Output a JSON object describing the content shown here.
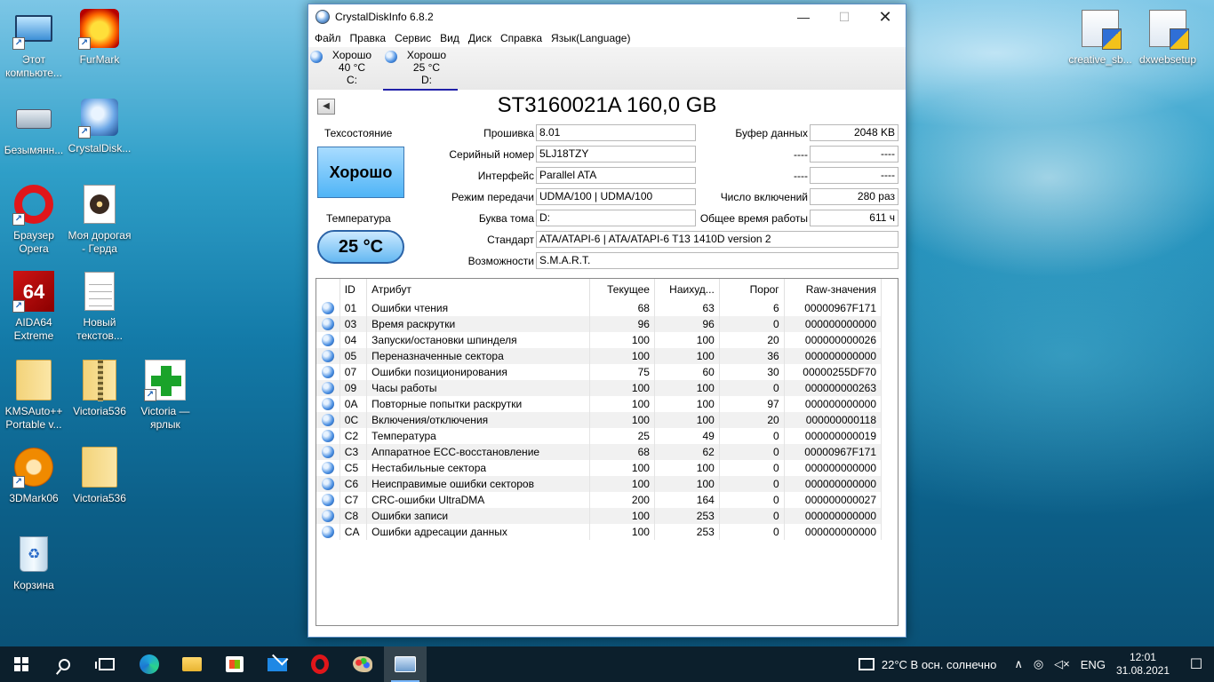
{
  "desktop": {
    "icons": [
      {
        "label": "Этот компьюте..."
      },
      {
        "label": "FurMark"
      },
      {
        "label": "Безымянн..."
      },
      {
        "label": "CrystalDisk..."
      },
      {
        "label": "Браузер Opera"
      },
      {
        "label": "Моя дорогая - Герда"
      },
      {
        "label": "AIDA64 Extreme",
        "badge": "64"
      },
      {
        "label": "Новый текстов..."
      },
      {
        "label": "KMSAuto++ Portable v..."
      },
      {
        "label": "Victoria536"
      },
      {
        "label": "Victoria — ярлык"
      },
      {
        "label": "3DMark06"
      },
      {
        "label": "Victoria536"
      },
      {
        "label": "Корзина"
      },
      {
        "label": "creative_sb..."
      },
      {
        "label": "dxwebsetup"
      }
    ]
  },
  "window": {
    "title": "CrystalDiskInfo 6.8.2",
    "controls": {
      "minimize": "—",
      "maximize": "☐",
      "close": "✕"
    },
    "menu": [
      "Файл",
      "Правка",
      "Сервис",
      "Вид",
      "Диск",
      "Справка",
      "Язык(Language)"
    ],
    "drives": [
      {
        "status": "Хорошо",
        "temp": "40 °C",
        "letter": "C:"
      },
      {
        "status": "Хорошо",
        "temp": "25 °C",
        "letter": "D:"
      }
    ],
    "model": "ST3160021A 160,0 GB",
    "health_label": "Техсостояние",
    "health_status": "Хорошо",
    "temp_label": "Температура",
    "temp_value": "25 °C",
    "fields": {
      "firmware": {
        "label": "Прошивка",
        "value": "8.01"
      },
      "serial": {
        "label": "Серийный номер",
        "value": "5LJ18TZY"
      },
      "interface": {
        "label": "Интерфейс",
        "value": "Parallel ATA"
      },
      "transfer": {
        "label": "Режим передачи",
        "value": "UDMA/100 | UDMA/100"
      },
      "volume": {
        "label": "Буква тома",
        "value": "D:"
      },
      "standard": {
        "label": "Стандарт",
        "value": "ATA/ATAPI-6 | ATA/ATAPI-6 T13 1410D version 2"
      },
      "features": {
        "label": "Возможности",
        "value": "S.M.A.R.T."
      },
      "buffer": {
        "label": "Буфер данных",
        "value": "2048 KB"
      },
      "blank1": {
        "label": "----",
        "value": "----"
      },
      "blank2": {
        "label": "----",
        "value": "----"
      },
      "power_count": {
        "label": "Число включений",
        "value": "280 раз"
      },
      "power_hours": {
        "label": "Общее время работы",
        "value": "611 ч"
      }
    },
    "smart": {
      "headers": {
        "id": "ID",
        "attr": "Атрибут",
        "current": "Текущее",
        "worst": "Наихуд...",
        "threshold": "Порог",
        "raw": "Raw-значения"
      },
      "rows": [
        {
          "id": "01",
          "attr": "Ошибки чтения",
          "current": "68",
          "worst": "63",
          "threshold": "6",
          "raw": "00000967F171"
        },
        {
          "id": "03",
          "attr": "Время раскрутки",
          "current": "96",
          "worst": "96",
          "threshold": "0",
          "raw": "000000000000"
        },
        {
          "id": "04",
          "attr": "Запуски/остановки шпинделя",
          "current": "100",
          "worst": "100",
          "threshold": "20",
          "raw": "000000000026"
        },
        {
          "id": "05",
          "attr": "Переназначенные сектора",
          "current": "100",
          "worst": "100",
          "threshold": "36",
          "raw": "000000000000"
        },
        {
          "id": "07",
          "attr": "Ошибки позиционирования",
          "current": "75",
          "worst": "60",
          "threshold": "30",
          "raw": "00000255DF70"
        },
        {
          "id": "09",
          "attr": "Часы работы",
          "current": "100",
          "worst": "100",
          "threshold": "0",
          "raw": "000000000263"
        },
        {
          "id": "0A",
          "attr": "Повторные попытки раскрутки",
          "current": "100",
          "worst": "100",
          "threshold": "97",
          "raw": "000000000000"
        },
        {
          "id": "0C",
          "attr": "Включения/отключения",
          "current": "100",
          "worst": "100",
          "threshold": "20",
          "raw": "000000000118"
        },
        {
          "id": "C2",
          "attr": "Температура",
          "current": "25",
          "worst": "49",
          "threshold": "0",
          "raw": "000000000019"
        },
        {
          "id": "C3",
          "attr": "Аппаратное ECC-восстановление",
          "current": "68",
          "worst": "62",
          "threshold": "0",
          "raw": "00000967F171"
        },
        {
          "id": "C5",
          "attr": "Нестабильные сектора",
          "current": "100",
          "worst": "100",
          "threshold": "0",
          "raw": "000000000000"
        },
        {
          "id": "C6",
          "attr": "Неисправимые ошибки секторов",
          "current": "100",
          "worst": "100",
          "threshold": "0",
          "raw": "000000000000"
        },
        {
          "id": "C7",
          "attr": "CRC-ошибки UltraDMA",
          "current": "200",
          "worst": "164",
          "threshold": "0",
          "raw": "000000000027"
        },
        {
          "id": "C8",
          "attr": "Ошибки записи",
          "current": "100",
          "worst": "253",
          "threshold": "0",
          "raw": "000000000000"
        },
        {
          "id": "CA",
          "attr": "Ошибки адресации данных",
          "current": "100",
          "worst": "253",
          "threshold": "0",
          "raw": "000000000000"
        }
      ]
    }
  },
  "taskbar": {
    "weather": "22°C  В осн. солнечно",
    "tray_chevron": "∧",
    "language": "ENG",
    "time": "12:01",
    "date": "31.08.2021",
    "notification": "☐"
  }
}
